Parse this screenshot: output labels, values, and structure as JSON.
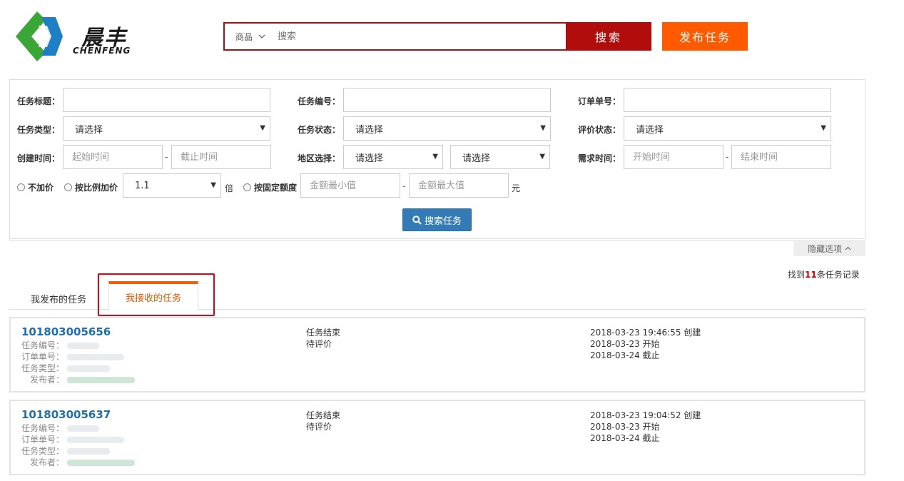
{
  "brand": {
    "cn": "晨丰",
    "en": "CHENFENG",
    "colors": {
      "green": "#3aa635",
      "blue": "#1f7fc4"
    }
  },
  "search": {
    "category": "商品",
    "placeholder": "搜索",
    "button": "搜索"
  },
  "publish_button": "发布任务",
  "filters": {
    "task_title_label": "任务标题：",
    "task_no_label": "任务编号：",
    "order_no_label": "订单单号：",
    "task_type_label": "任务类型：",
    "task_type_value": "请选择",
    "task_status_label": "任务状态：",
    "task_status_value": "请选择",
    "review_status_label": "评价状态：",
    "review_status_value": "请选择",
    "create_time_label": "创建时间：",
    "create_start_placeholder": "起始时间",
    "create_end_placeholder": "截止时间",
    "region_label": "地区选择：",
    "region_value_1": "请选择",
    "region_value_2": "请选择",
    "need_time_label": "需求时间：",
    "need_start_placeholder": "开始时间",
    "need_end_placeholder": "结束时间",
    "dash": "-",
    "radio_no_markup": "不加价",
    "radio_ratio_markup": "按比例加价",
    "ratio_value": "1.1",
    "ratio_unit": "倍",
    "radio_fixed_markup": "按固定额度",
    "amount_min_placeholder": "金额最小值",
    "amount_max_placeholder": "金额最大值",
    "amount_unit": "元",
    "search_task_button": "搜索任务"
  },
  "hide_options": "隐藏选项",
  "found": {
    "prefix": "找到",
    "count": "11",
    "suffix": "条任务记录"
  },
  "tabs": [
    {
      "label": "我发布的任务"
    },
    {
      "label": "我接收的任务",
      "active": true
    }
  ],
  "tasks": [
    {
      "id": "101803005656",
      "fields": {
        "task_no": "任务编号：",
        "order_no": "订单单号：",
        "task_type": "任务类型：",
        "publisher": "发布者："
      },
      "status": "任务结束",
      "review": "待评价",
      "created": "2018-03-23 19:46:55 创建",
      "start": "2018-03-23 开始",
      "end": "2018-03-24 截止"
    },
    {
      "id": "101803005637",
      "fields": {
        "task_no": "任务编号：",
        "order_no": "订单单号：",
        "task_type": "任务类型：",
        "publisher": "发布者："
      },
      "status": "任务结束",
      "review": "待评价",
      "created": "2018-03-23 19:04:52 创建",
      "start": "2018-03-23 开始",
      "end": "2018-03-24 截止"
    }
  ]
}
